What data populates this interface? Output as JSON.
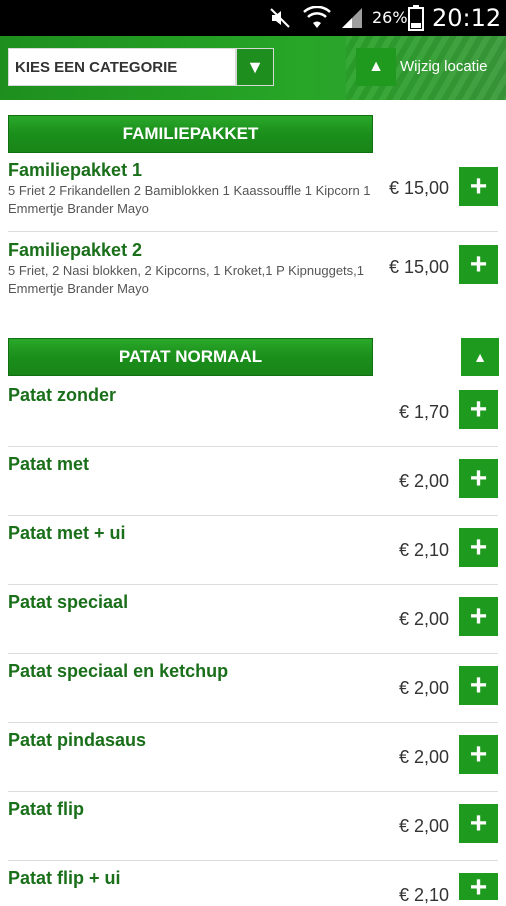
{
  "status_bar": {
    "icons": [
      "mute-icon",
      "wifi-icon",
      "signal-icon",
      "battery-icon"
    ],
    "battery": "26%",
    "time": "20:12"
  },
  "topbar": {
    "category_placeholder": "KIES EEN CATEGORIE",
    "dropdown_icon": "triangle-down-icon",
    "location_icon": "triangle-up-icon",
    "location_label": "Wijzig locatie"
  },
  "colors": {
    "accent": "#1e9a1e",
    "item_name": "#1a6f1a"
  },
  "sections": [
    {
      "title": "FAMILIEPAKKET",
      "items": [
        {
          "name": "Familiepakket 1",
          "desc": "5 Friet 2 Frikandellen 2 Bamiblokken 1 Kaassouffle 1 Kipcorn 1 Emmertje Brander Mayo",
          "price": "€ 15,00"
        },
        {
          "name": "Familiepakket 2",
          "desc": "5 Friet, 2 Nasi blokken, 2 Kipcorns, 1 Kroket,1 P Kipnuggets,1 Emmertje Brander Mayo",
          "price": "€ 15,00"
        }
      ]
    },
    {
      "title": "PATAT NORMAAL",
      "items": [
        {
          "name": "Patat zonder",
          "price": "€ 1,70"
        },
        {
          "name": "Patat met",
          "price": "€ 2,00"
        },
        {
          "name": "Patat met + ui",
          "price": "€ 2,10"
        },
        {
          "name": "Patat speciaal",
          "price": "€ 2,00"
        },
        {
          "name": "Patat speciaal en ketchup",
          "price": "€ 2,00"
        },
        {
          "name": "Patat pindasaus",
          "price": "€ 2,00"
        },
        {
          "name": "Patat flip",
          "price": "€ 2,00"
        },
        {
          "name": "Patat flip + ui",
          "price": "€ 2,10"
        }
      ]
    }
  ],
  "add_icon": "+",
  "collapse_icon": "▲"
}
